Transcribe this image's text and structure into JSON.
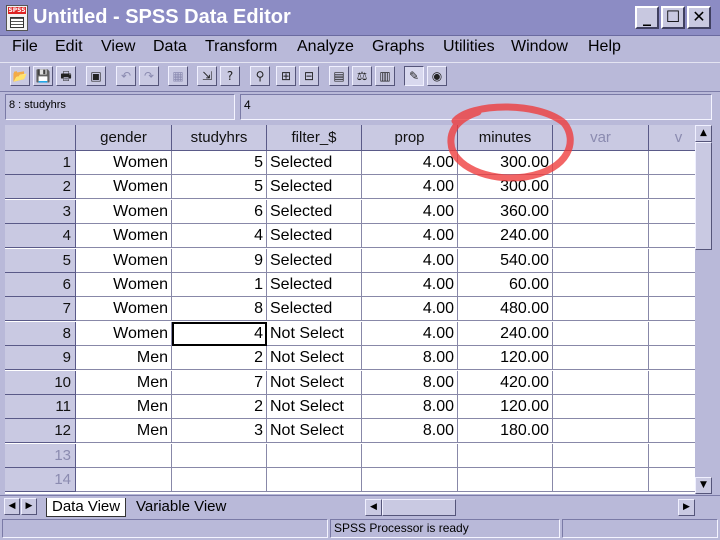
{
  "window": {
    "title": "Untitled - SPSS Data Editor",
    "icon_label": "SPSS",
    "minimize_label": "_",
    "maximize_label": "☐",
    "close_label": "✕"
  },
  "menu": [
    "File",
    "Edit",
    "View",
    "Data",
    "Transform",
    "Analyze",
    "Graphs",
    "Utilities",
    "Window",
    "Help"
  ],
  "toolbar": {
    "icons": [
      "open-icon",
      "save-icon",
      "print-icon",
      "dialog-recall-icon",
      "undo-icon",
      "redo-icon",
      "goto-chart-icon",
      "goto-case-icon",
      "variables-icon",
      "find-icon",
      "insert-case-icon",
      "insert-variable-icon",
      "split-file-icon",
      "weight-cases-icon",
      "select-cases-icon",
      "value-labels-icon",
      "use-sets-icon"
    ]
  },
  "cell_editor": {
    "cell_ref": "8 : studyhrs",
    "cell_value": "4"
  },
  "grid": {
    "columns": [
      "gender",
      "studyhrs",
      "filter_$",
      "prop",
      "minutes",
      "var",
      "v"
    ],
    "rows": [
      {
        "num": "1",
        "gender": "Women",
        "studyhrs": "5",
        "filter": "Selected",
        "prop": "4.00",
        "minutes": "300.00"
      },
      {
        "num": "2",
        "gender": "Women",
        "studyhrs": "5",
        "filter": "Selected",
        "prop": "4.00",
        "minutes": "300.00"
      },
      {
        "num": "3",
        "gender": "Women",
        "studyhrs": "6",
        "filter": "Selected",
        "prop": "4.00",
        "minutes": "360.00"
      },
      {
        "num": "4",
        "gender": "Women",
        "studyhrs": "4",
        "filter": "Selected",
        "prop": "4.00",
        "minutes": "240.00"
      },
      {
        "num": "5",
        "gender": "Women",
        "studyhrs": "9",
        "filter": "Selected",
        "prop": "4.00",
        "minutes": "540.00"
      },
      {
        "num": "6",
        "gender": "Women",
        "studyhrs": "1",
        "filter": "Selected",
        "prop": "4.00",
        "minutes": "60.00"
      },
      {
        "num": "7",
        "gender": "Women",
        "studyhrs": "8",
        "filter": "Selected",
        "prop": "4.00",
        "minutes": "480.00"
      },
      {
        "num": "8",
        "gender": "Women",
        "studyhrs": "4",
        "filter": "Not Select",
        "prop": "4.00",
        "minutes": "240.00"
      },
      {
        "num": "9",
        "gender": "Men",
        "studyhrs": "2",
        "filter": "Not Select",
        "prop": "8.00",
        "minutes": "120.00"
      },
      {
        "num": "10",
        "gender": "Men",
        "studyhrs": "7",
        "filter": "Not Select",
        "prop": "8.00",
        "minutes": "420.00"
      },
      {
        "num": "11",
        "gender": "Men",
        "studyhrs": "2",
        "filter": "Not Select",
        "prop": "8.00",
        "minutes": "120.00"
      },
      {
        "num": "12",
        "gender": "Men",
        "studyhrs": "3",
        "filter": "Not Select",
        "prop": "8.00",
        "minutes": "180.00"
      },
      {
        "num": "13",
        "gender": "",
        "studyhrs": "",
        "filter": "",
        "prop": "",
        "minutes": ""
      },
      {
        "num": "14",
        "gender": "",
        "studyhrs": "",
        "filter": "",
        "prop": "",
        "minutes": ""
      }
    ]
  },
  "tabs": {
    "data_view": "Data View",
    "variable_view": "Variable View"
  },
  "status": {
    "processor": "SPSS Processor  is ready"
  },
  "colors": {
    "title_bar": "#8c8cc4",
    "chrome": "#b9b9d9",
    "annotation_circle": "#ee3a3a"
  }
}
